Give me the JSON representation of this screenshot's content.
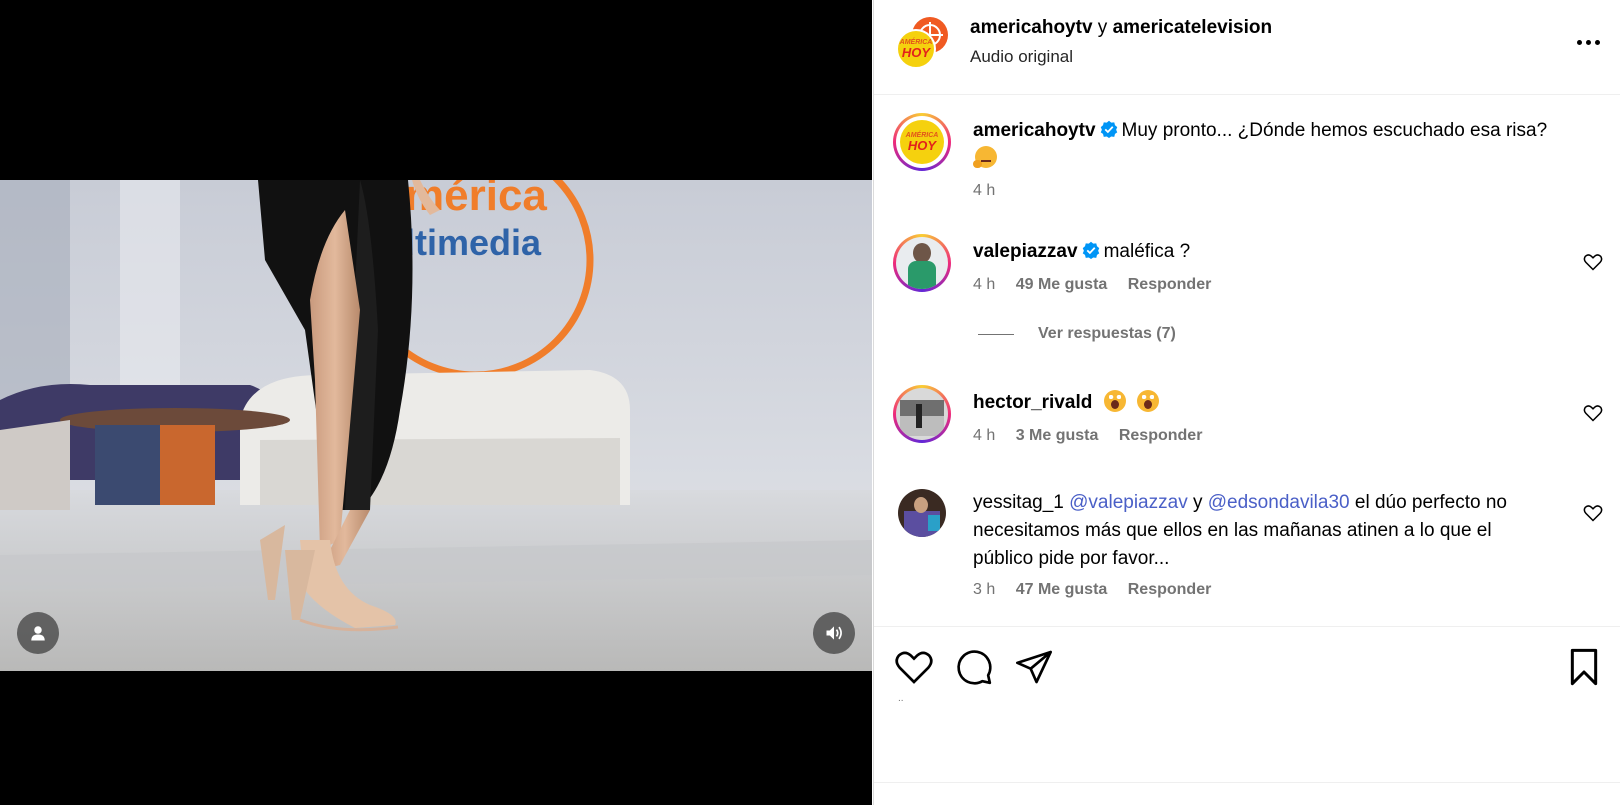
{
  "media": {
    "user_tag_icon": "user-icon",
    "volume_icon": "volume-icon",
    "backdrop_logo": {
      "line1": "mérica",
      "line2": "ltimedia"
    }
  },
  "header": {
    "account": "americahoytv",
    "joiner": "y",
    "collaborator": "americatelevision",
    "audio": "Audio original",
    "logo": {
      "line1": "AMÉRICA",
      "line2": "HOY"
    },
    "more_icon": "more-horizontal-icon"
  },
  "caption": {
    "user": "americahoytv",
    "text": "Muy pronto... ¿Dónde hemos escuchado esa risa?",
    "time": "4 h"
  },
  "comments": [
    {
      "user": "valepiazzav",
      "verified": true,
      "text": "maléfica ?",
      "time": "4 h",
      "likes": "49 Me gusta",
      "reply": "Responder",
      "view_replies": "Ver respuestas (7)"
    },
    {
      "user": "hector_rivald",
      "verified": false,
      "text": "",
      "time": "4 h",
      "likes": "3 Me gusta",
      "reply": "Responder"
    },
    {
      "user": "yessitag_1",
      "verified": false,
      "mention1": "@valepiazzav",
      "joiner": "y",
      "mention2": "@edsondavila30",
      "text": "el dúo perfecto no necesitamos más que ellos en las mañanas atinen a lo que el público pide por favor...",
      "time": "3 h",
      "likes": "47 Me gusta",
      "reply": "Responder"
    }
  ],
  "actions": {
    "like_icon": "heart-icon",
    "comment_icon": "comment-icon",
    "share_icon": "send-icon",
    "save_icon": "bookmark-icon",
    "likes_line": ".."
  },
  "colors": {
    "mention": "#4a5fc7",
    "verified": "#0095f6",
    "muted_text": "#737373"
  }
}
